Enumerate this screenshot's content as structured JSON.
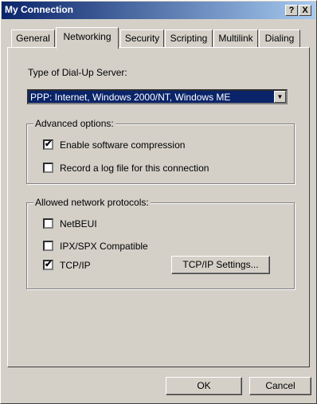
{
  "window": {
    "title": "My Connection",
    "help_button": "?",
    "close_button": "X"
  },
  "tabs": [
    "General",
    "Networking",
    "Security",
    "Scripting",
    "Multilink",
    "Dialing"
  ],
  "server": {
    "label": "Type of Dial-Up Server:",
    "selected": "PPP: Internet, Windows 2000/NT, Windows ME"
  },
  "advanced": {
    "title": "Advanced options:",
    "compression": {
      "label": "Enable software compression",
      "checked": true
    },
    "logfile": {
      "label": "Record a log file for this connection",
      "checked": false
    }
  },
  "protocols": {
    "title": "Allowed network protocols:",
    "netbeui": {
      "label": "NetBEUI",
      "checked": false
    },
    "ipx": {
      "label": "IPX/SPX Compatible",
      "checked": false
    },
    "tcpip": {
      "label": "TCP/IP",
      "checked": true
    },
    "settings_button": "TCP/IP Settings..."
  },
  "footer": {
    "ok": "OK",
    "cancel": "Cancel"
  },
  "check_glyph": "✔"
}
